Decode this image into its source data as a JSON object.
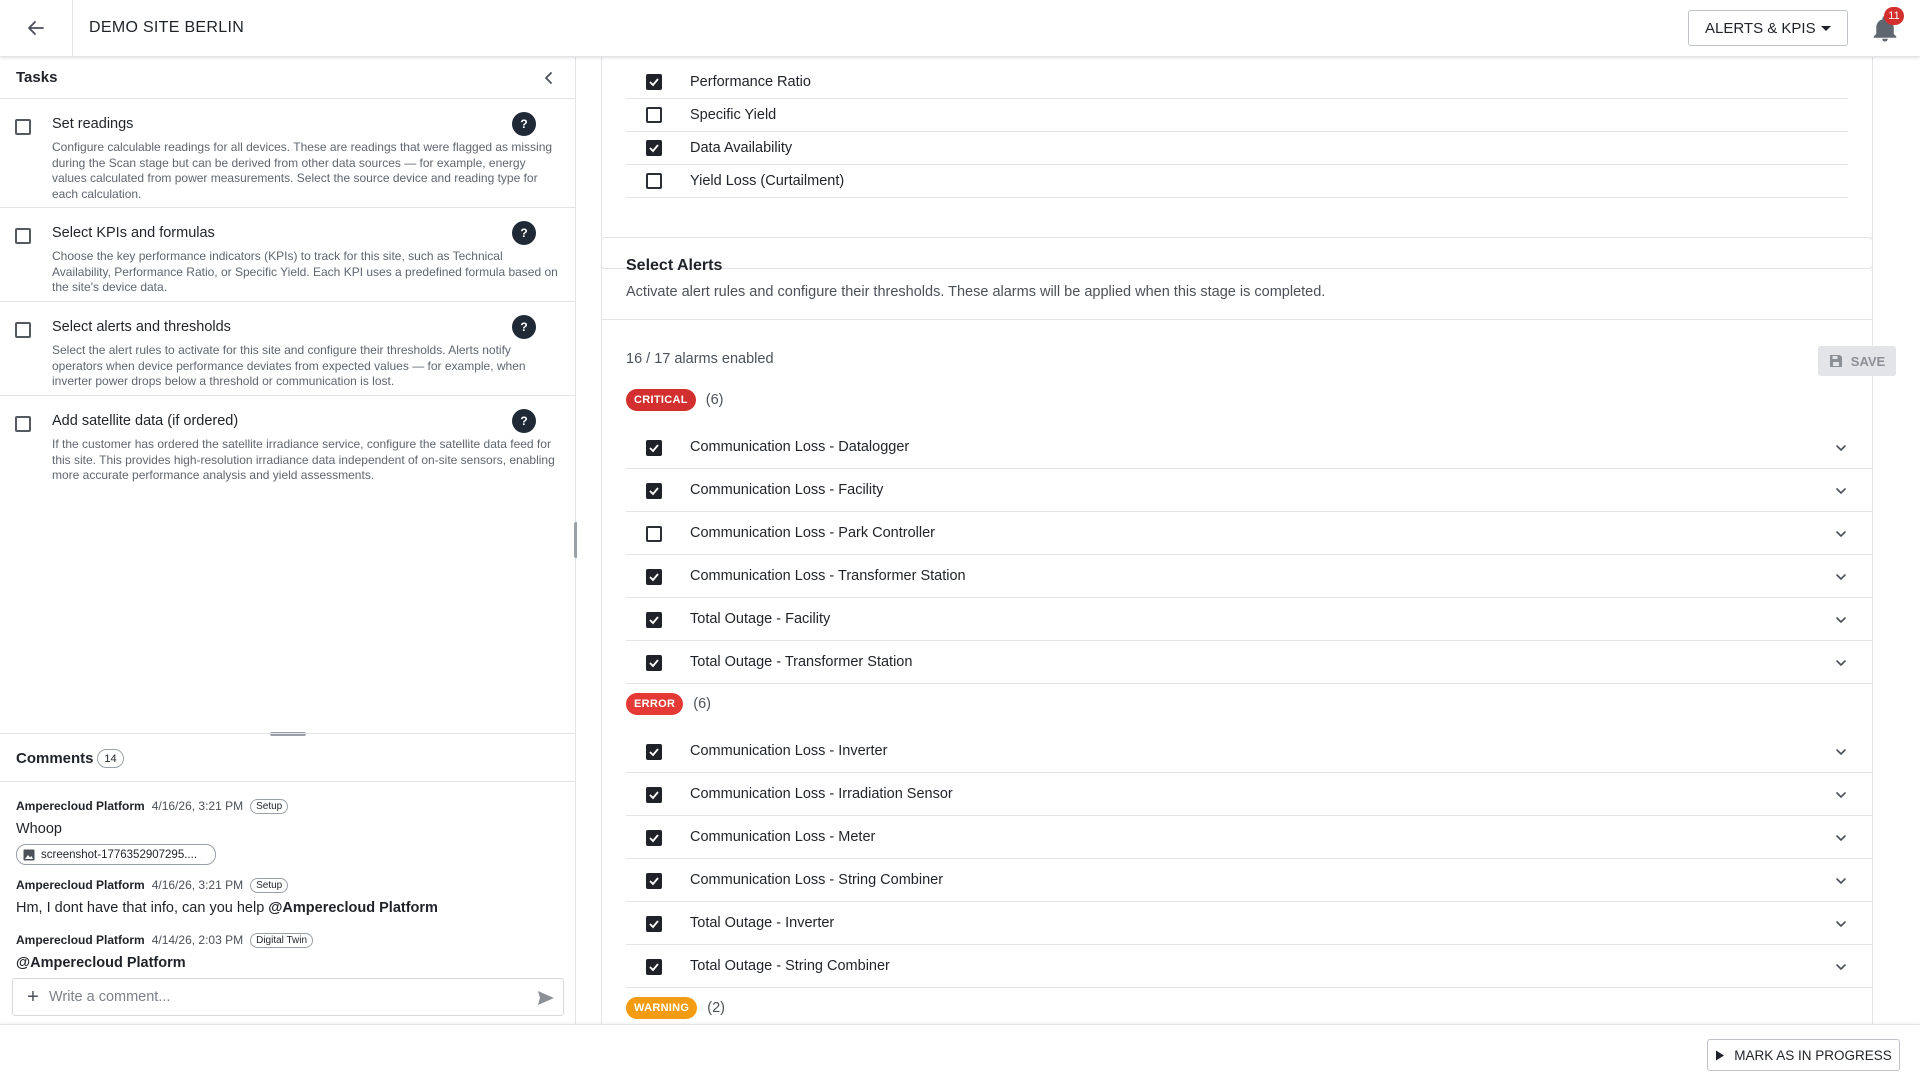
{
  "header": {
    "site_title": "DEMO SITE BERLIN",
    "stage_select": "ALERTS & KPIS",
    "notifications_count": "11"
  },
  "tasks": {
    "title": "Tasks",
    "items": [
      {
        "title": "Set readings",
        "checked": false,
        "help": "?",
        "description": "Configure calculable readings for all devices. These are readings that were flagged as missing during the Scan stage but can be derived from other data sources — for example, energy values calculated from power measurements. Select the source device and reading type for each calculation."
      },
      {
        "title": "Select KPIs and formulas",
        "checked": false,
        "help": "?",
        "description": "Choose the key performance indicators (KPIs) to track for this site, such as Technical Availability, Performance Ratio, or Specific Yield. Each KPI uses a predefined formula based on the site's device data."
      },
      {
        "title": "Select alerts and thresholds",
        "checked": false,
        "help": "?",
        "description": "Select the alert rules to activate for this site and configure their thresholds. Alerts notify operators when device performance deviates from expected values — for example, when inverter power drops below a threshold or communication is lost."
      },
      {
        "title": "Add satellite data (if ordered)",
        "checked": false,
        "help": "?",
        "description": "If the customer has ordered the satellite irradiance service, configure the satellite data feed for this site. This provides high-resolution irradiance data independent of on-site sensors, enabling more accurate performance analysis and yield assessments."
      }
    ]
  },
  "comments": {
    "title": "Comments",
    "count": "14",
    "items": [
      {
        "author": "Amperecloud Platform",
        "date": "4/16/26, 3:21 PM",
        "tag": "Setup",
        "text": "Whoop",
        "attachment": "screenshot-1776352907295...."
      },
      {
        "author": "Amperecloud Platform",
        "date": "4/16/26, 3:21 PM",
        "tag": "Setup",
        "text": "Hm, I dont have that info, can you help ",
        "mention": "@Amperecloud Platform"
      },
      {
        "author": "Amperecloud Platform",
        "date": "4/14/26, 2:03 PM",
        "tag": "Digital Twin",
        "mention": "@Amperecloud Platform"
      }
    ],
    "input_placeholder": "Write a comment..."
  },
  "kpis": [
    {
      "label": "Performance Ratio",
      "checked": true
    },
    {
      "label": "Specific Yield",
      "checked": false
    },
    {
      "label": "Data Availability",
      "checked": true
    },
    {
      "label": "Yield Loss (Curtailment)",
      "checked": false
    }
  ],
  "alerts": {
    "title": "Select Alerts",
    "description": "Activate alert rules and configure their thresholds. These alarms will be applied when this stage is completed.",
    "enabled_summary": "16 / 17 alarms enabled",
    "save_label": "SAVE",
    "groups": [
      {
        "severity": "CRITICAL",
        "count": "(6)",
        "color": "#d32f2f",
        "items": [
          {
            "label": "Communication Loss - Datalogger",
            "checked": true
          },
          {
            "label": "Communication Loss - Facility",
            "checked": true
          },
          {
            "label": "Communication Loss - Park Controller",
            "checked": false
          },
          {
            "label": "Communication Loss - Transformer Station",
            "checked": true
          },
          {
            "label": "Total Outage - Facility",
            "checked": true
          },
          {
            "label": "Total Outage - Transformer Station",
            "checked": true
          }
        ]
      },
      {
        "severity": "ERROR",
        "count": "(6)",
        "color": "#e53935",
        "items": [
          {
            "label": "Communication Loss - Inverter",
            "checked": true
          },
          {
            "label": "Communication Loss - Irradiation Sensor",
            "checked": true
          },
          {
            "label": "Communication Loss - Meter",
            "checked": true
          },
          {
            "label": "Communication Loss - String Combiner",
            "checked": true
          },
          {
            "label": "Total Outage - Inverter",
            "checked": true
          },
          {
            "label": "Total Outage - String Combiner",
            "checked": true
          }
        ]
      },
      {
        "severity": "WARNING",
        "count": "(2)",
        "color": "#f39c12",
        "items": []
      }
    ]
  },
  "footer": {
    "mark_progress_label": "MARK AS IN PROGRESS"
  }
}
